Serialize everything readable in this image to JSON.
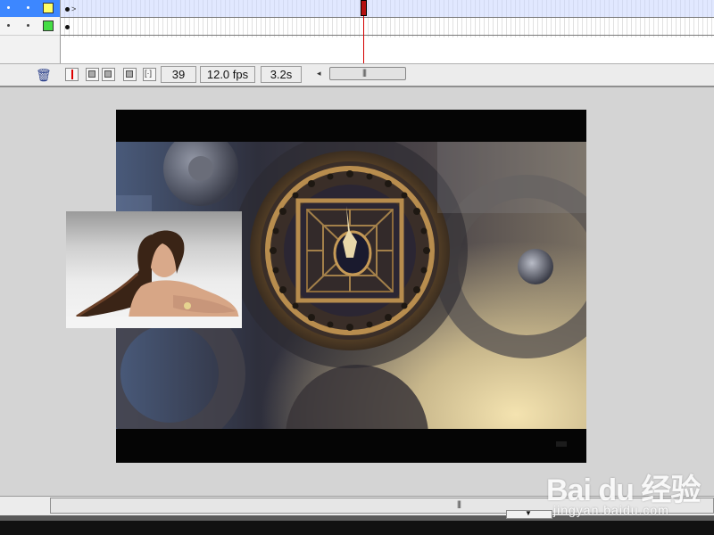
{
  "timeline": {
    "current_frame": "39",
    "frame_rate": "12.0 fps",
    "elapsed_time": "3.2s",
    "layers": [
      {
        "color": "#ffff66",
        "selected": true
      },
      {
        "color": "#44dd44",
        "selected": false
      }
    ],
    "icons": {
      "delete": "trash-icon",
      "center": "center-frame-icon",
      "onion_skin": "onion-skin-icon",
      "onion_outlines": "onion-skin-outlines-icon",
      "edit_multiple": "edit-multiple-frames-icon",
      "modify_markers": "modify-onion-markers-icon"
    }
  },
  "watermark": {
    "brand": "Bai du 经验",
    "site": "jingyan.baidu.com"
  },
  "colors": {
    "selected_layer": "#3d87ff",
    "playhead": "#d40000",
    "stage_bg": "#050505",
    "workspace_bg": "#d4d4d4"
  }
}
